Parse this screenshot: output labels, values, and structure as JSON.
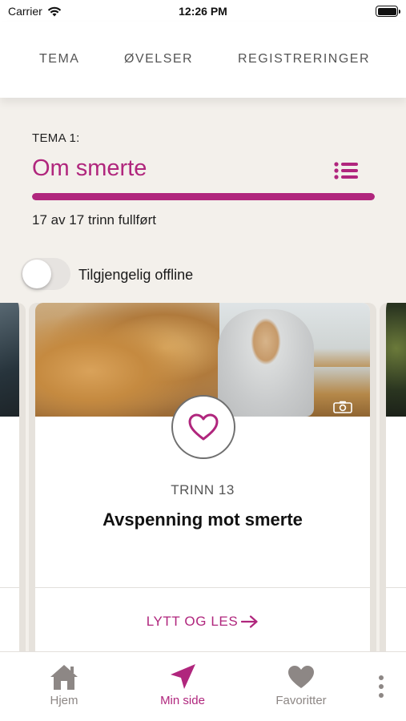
{
  "status_bar": {
    "carrier": "Carrier",
    "time": "12:26 PM"
  },
  "top_tabs": [
    {
      "label": "TEMA"
    },
    {
      "label": "ØVELSER"
    },
    {
      "label": "REGISTRERINGER"
    }
  ],
  "theme": {
    "label": "TEMA 1:",
    "title": "Om smerte",
    "progress_fraction": 1.0,
    "progress_text": "17 av 17 trinn fullført"
  },
  "offline_toggle": {
    "label": "Tilgjengelig offline",
    "on": false
  },
  "card": {
    "step_label": "TRINN 13",
    "title": "Avspenning mot smerte",
    "action_label": "LYTT OG LES",
    "favorite": false
  },
  "bottom_nav": [
    {
      "label": "Hjem",
      "icon": "home-icon",
      "active": false
    },
    {
      "label": "Min side",
      "icon": "navigation-arrow-icon",
      "active": true
    },
    {
      "label": "Favoritter",
      "icon": "heart-icon",
      "active": false
    }
  ],
  "colors": {
    "accent": "#b0267d",
    "background": "#f3f0eb",
    "inactive_nav": "#8d8785"
  }
}
